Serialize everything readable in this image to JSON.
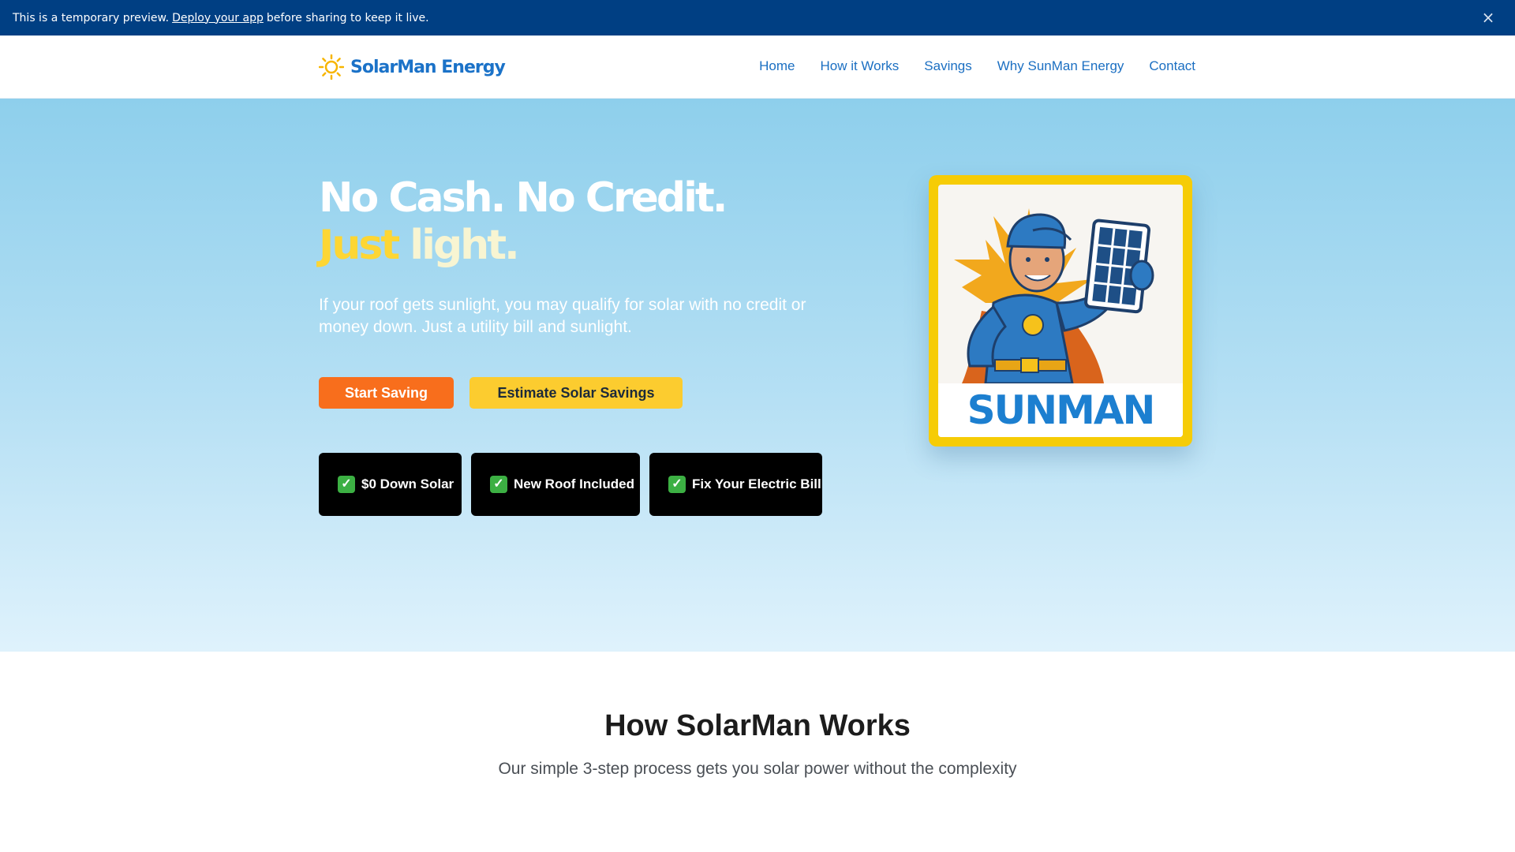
{
  "banner": {
    "text_before": "This is a temporary preview.",
    "link": "Deploy your app",
    "text_after": "before sharing to keep it live.",
    "close_icon": "close-icon"
  },
  "header": {
    "logo_icon": "sun-icon",
    "logo_text": "SolarMan Energy",
    "nav": [
      "Home",
      "How it Works",
      "Savings",
      "Why SunMan Energy",
      "Contact"
    ]
  },
  "hero": {
    "headline_line1": "No Cash. No Credit.",
    "headline_just": "Just",
    "headline_light": "light.",
    "subtitle": "If your roof gets sunlight, you may qualify for solar with no credit or money down. Just a utility bill and sunlight.",
    "primary_button": "Start Saving",
    "secondary_button": "Estimate Solar Savings",
    "features": [
      "$0 Down Solar",
      "New Roof Included",
      "Fix Your Electric Bill"
    ],
    "check_icon": "check-mark-icon",
    "mascot_word": "SUNMAN",
    "mascot_image": "superhero-mascot-holding-solar-panel"
  },
  "how_section": {
    "title": "How SolarMan Works",
    "subtitle": "Our simple 3-step process gets you solar power without the complexity"
  },
  "colors": {
    "banner_bg": "#003f83",
    "brand_blue": "#1b72c8",
    "primary_orange": "#f86e1c",
    "secondary_yellow": "#fccc2f",
    "card_yellow": "#f6cc06"
  }
}
